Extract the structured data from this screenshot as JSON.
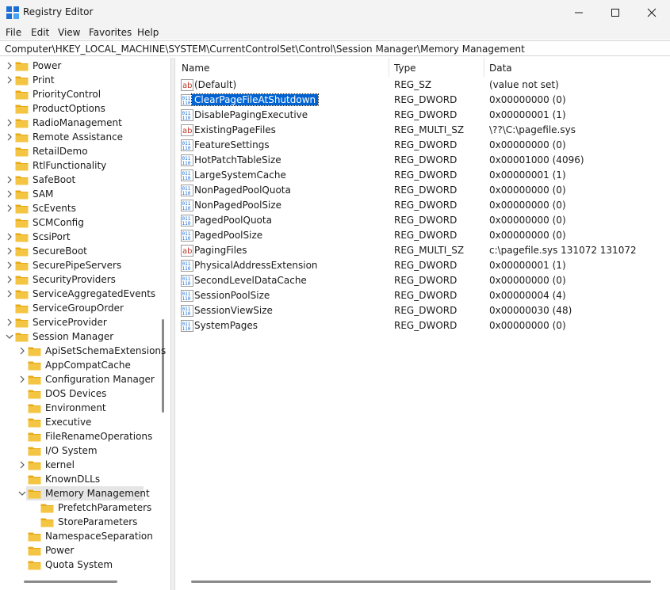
{
  "window": {
    "title": "Registry Editor"
  },
  "menu": [
    "File",
    "Edit",
    "View",
    "Favorites",
    "Help"
  ],
  "address": "Computer\\HKEY_LOCAL_MACHINE\\SYSTEM\\CurrentControlSet\\Control\\Session Manager\\Memory Management",
  "tree": [
    {
      "label": "Power",
      "level": 0,
      "expander": "collapsed"
    },
    {
      "label": "Print",
      "level": 0,
      "expander": "collapsed"
    },
    {
      "label": "PriorityControl",
      "level": 0,
      "expander": "none"
    },
    {
      "label": "ProductOptions",
      "level": 0,
      "expander": "none"
    },
    {
      "label": "RadioManagement",
      "level": 0,
      "expander": "collapsed"
    },
    {
      "label": "Remote Assistance",
      "level": 0,
      "expander": "collapsed"
    },
    {
      "label": "RetailDemo",
      "level": 0,
      "expander": "none"
    },
    {
      "label": "RtlFunctionality",
      "level": 0,
      "expander": "none"
    },
    {
      "label": "SafeBoot",
      "level": 0,
      "expander": "collapsed"
    },
    {
      "label": "SAM",
      "level": 0,
      "expander": "collapsed"
    },
    {
      "label": "ScEvents",
      "level": 0,
      "expander": "collapsed"
    },
    {
      "label": "SCMConfig",
      "level": 0,
      "expander": "none"
    },
    {
      "label": "ScsiPort",
      "level": 0,
      "expander": "collapsed"
    },
    {
      "label": "SecureBoot",
      "level": 0,
      "expander": "collapsed"
    },
    {
      "label": "SecurePipeServers",
      "level": 0,
      "expander": "collapsed"
    },
    {
      "label": "SecurityProviders",
      "level": 0,
      "expander": "collapsed"
    },
    {
      "label": "ServiceAggregatedEvents",
      "level": 0,
      "expander": "collapsed"
    },
    {
      "label": "ServiceGroupOrder",
      "level": 0,
      "expander": "none"
    },
    {
      "label": "ServiceProvider",
      "level": 0,
      "expander": "collapsed"
    },
    {
      "label": "Session Manager",
      "level": 0,
      "expander": "expanded"
    },
    {
      "label": "ApiSetSchemaExtensions",
      "level": 1,
      "expander": "collapsed"
    },
    {
      "label": "AppCompatCache",
      "level": 1,
      "expander": "none"
    },
    {
      "label": "Configuration Manager",
      "level": 1,
      "expander": "collapsed"
    },
    {
      "label": "DOS Devices",
      "level": 1,
      "expander": "none"
    },
    {
      "label": "Environment",
      "level": 1,
      "expander": "none"
    },
    {
      "label": "Executive",
      "level": 1,
      "expander": "none"
    },
    {
      "label": "FileRenameOperations",
      "level": 1,
      "expander": "none"
    },
    {
      "label": "I/O System",
      "level": 1,
      "expander": "none"
    },
    {
      "label": "kernel",
      "level": 1,
      "expander": "collapsed"
    },
    {
      "label": "KnownDLLs",
      "level": 1,
      "expander": "none"
    },
    {
      "label": "Memory Management",
      "level": 1,
      "expander": "expanded",
      "selected": true
    },
    {
      "label": "PrefetchParameters",
      "level": 2,
      "expander": "none"
    },
    {
      "label": "StoreParameters",
      "level": 2,
      "expander": "none"
    },
    {
      "label": "NamespaceSeparation",
      "level": 1,
      "expander": "none"
    },
    {
      "label": "Power",
      "level": 1,
      "expander": "none"
    },
    {
      "label": "Quota System",
      "level": 1,
      "expander": "none"
    }
  ],
  "columns": {
    "name": "Name",
    "type": "Type",
    "data": "Data"
  },
  "values": [
    {
      "name": "(Default)",
      "type": "REG_SZ",
      "data": "(value not set)",
      "icon": "string-value-icon"
    },
    {
      "name": "ClearPageFileAtShutdown",
      "type": "REG_DWORD",
      "data": "0x00000000 (0)",
      "icon": "binary-value-icon",
      "selected": true
    },
    {
      "name": "DisablePagingExecutive",
      "type": "REG_DWORD",
      "data": "0x00000001 (1)",
      "icon": "binary-value-icon"
    },
    {
      "name": "ExistingPageFiles",
      "type": "REG_MULTI_SZ",
      "data": "\\??\\C:\\pagefile.sys",
      "icon": "string-value-icon"
    },
    {
      "name": "FeatureSettings",
      "type": "REG_DWORD",
      "data": "0x00000000 (0)",
      "icon": "binary-value-icon"
    },
    {
      "name": "HotPatchTableSize",
      "type": "REG_DWORD",
      "data": "0x00001000 (4096)",
      "icon": "binary-value-icon"
    },
    {
      "name": "LargeSystemCache",
      "type": "REG_DWORD",
      "data": "0x00000001 (1)",
      "icon": "binary-value-icon"
    },
    {
      "name": "NonPagedPoolQuota",
      "type": "REG_DWORD",
      "data": "0x00000000 (0)",
      "icon": "binary-value-icon"
    },
    {
      "name": "NonPagedPoolSize",
      "type": "REG_DWORD",
      "data": "0x00000000 (0)",
      "icon": "binary-value-icon"
    },
    {
      "name": "PagedPoolQuota",
      "type": "REG_DWORD",
      "data": "0x00000000 (0)",
      "icon": "binary-value-icon"
    },
    {
      "name": "PagedPoolSize",
      "type": "REG_DWORD",
      "data": "0x00000000 (0)",
      "icon": "binary-value-icon"
    },
    {
      "name": "PagingFiles",
      "type": "REG_MULTI_SZ",
      "data": "c:\\pagefile.sys 131072 131072",
      "icon": "string-value-icon"
    },
    {
      "name": "PhysicalAddressExtension",
      "type": "REG_DWORD",
      "data": "0x00000001 (1)",
      "icon": "binary-value-icon"
    },
    {
      "name": "SecondLevelDataCache",
      "type": "REG_DWORD",
      "data": "0x00000000 (0)",
      "icon": "binary-value-icon"
    },
    {
      "name": "SessionPoolSize",
      "type": "REG_DWORD",
      "data": "0x00000004 (4)",
      "icon": "binary-value-icon"
    },
    {
      "name": "SessionViewSize",
      "type": "REG_DWORD",
      "data": "0x00000030 (48)",
      "icon": "binary-value-icon"
    },
    {
      "name": "SystemPages",
      "type": "REG_DWORD",
      "data": "0x00000000 (0)",
      "icon": "binary-value-icon"
    }
  ],
  "colors": {
    "selection": "#0063d3",
    "folder": "#f4c542",
    "accent": "#1b6fd6",
    "string_icon": "#c0392b"
  }
}
